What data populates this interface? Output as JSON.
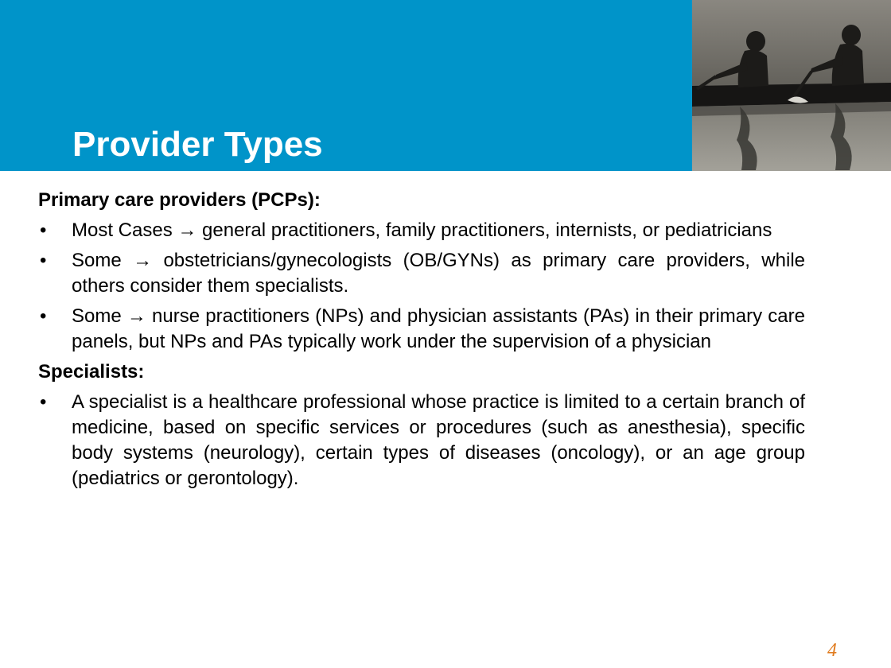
{
  "slide": {
    "title": "Provider Types",
    "page_number": "4",
    "photo_icon": "rowers-photo-icon"
  },
  "sections": [
    {
      "heading": "Primary care providers (PCPs):",
      "bullets": [
        "Most Cases → general practitioners, family practitioners, internists, or pediatricians",
        "Some → obstetricians/gynecologists (OB/GYNs) as primary care providers, while others consider them specialists.",
        "Some →  nurse practitioners (NPs) and physician assistants (PAs) in their primary care panels, but NPs and PAs typically work under the supervision of a physician"
      ]
    },
    {
      "heading": "Specialists:",
      "bullets": [
        "A specialist is a healthcare professional whose practice is limited to a certain branch of medicine, based on specific services or procedures (such as anesthesia), specific body systems (neurology), certain types of diseases (oncology), or an age group (pediatrics or gerontology)."
      ]
    }
  ],
  "bullet_marker": "•",
  "colors": {
    "header_band": "#0094c9",
    "title_text": "#ffffff",
    "body_text": "#000000",
    "page_number": "#e07b1e"
  }
}
